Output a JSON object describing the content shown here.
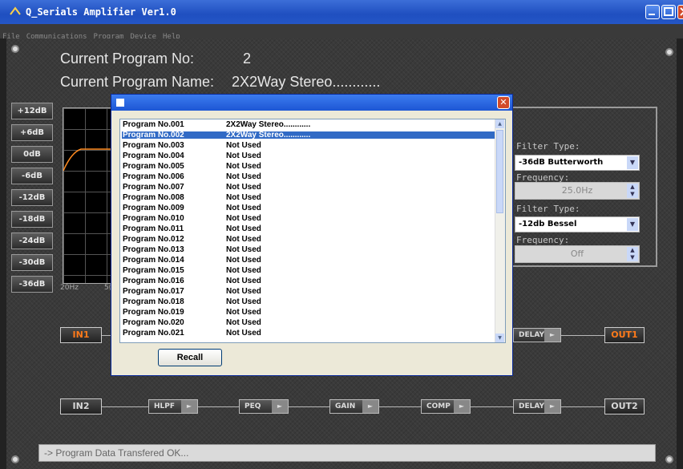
{
  "window": {
    "title": "Q_Serials Amplifier Ver1.0"
  },
  "menu": [
    "File",
    "Communications",
    "Program",
    "Device",
    "Help"
  ],
  "program": {
    "no_label": "Current Program No:",
    "no_value": "2",
    "name_label": "Current Program Name:",
    "name_value": "2X2Way Stereo............"
  },
  "db_buttons": [
    "+12dB",
    "+6dB",
    "0dB",
    "-6dB",
    "-12dB",
    "-18dB",
    "-24dB",
    "-30dB",
    "-36dB"
  ],
  "graph": {
    "x_label_start": "20Hz",
    "x_label_partial": "5("
  },
  "filters": {
    "hp_type_label": "Filter Type:",
    "hp_type_value": "-36dB Butterworth",
    "hp_freq_label": "Frequency:",
    "hp_freq_value": "25.0Hz",
    "lp_type_label": "Filter Type:",
    "lp_type_value": "-12db Bessel",
    "lp_freq_label": "Frequency:",
    "lp_freq_value": "Off"
  },
  "chain1": {
    "in": "IN1",
    "delay": "DELAY",
    "out": "OUT1"
  },
  "chain2": {
    "in": "IN2",
    "hlpf": "HLPF",
    "peq": "PEQ",
    "gain": "GAIN",
    "comp": "COMP",
    "delay": "DELAY",
    "out": "OUT2"
  },
  "colors": {
    "io_accent": "#ff7a1a",
    "selection": "#316ac5"
  },
  "dialog": {
    "close": "✕",
    "recall_label": "Recall",
    "programs": [
      {
        "no": "Program No.001",
        "name": "2X2Way Stereo............"
      },
      {
        "no": "Program No.002",
        "name": "2X2Way Stereo............",
        "selected": true
      },
      {
        "no": "Program No.003",
        "name": "Not Used"
      },
      {
        "no": "Program No.004",
        "name": "Not Used"
      },
      {
        "no": "Program No.005",
        "name": "Not Used"
      },
      {
        "no": "Program No.006",
        "name": "Not Used"
      },
      {
        "no": "Program No.007",
        "name": "Not Used"
      },
      {
        "no": "Program No.008",
        "name": "Not Used"
      },
      {
        "no": "Program No.009",
        "name": "Not Used"
      },
      {
        "no": "Program No.010",
        "name": "Not Used"
      },
      {
        "no": "Program No.011",
        "name": "Not Used"
      },
      {
        "no": "Program No.012",
        "name": "Not Used"
      },
      {
        "no": "Program No.013",
        "name": "Not Used"
      },
      {
        "no": "Program No.014",
        "name": "Not Used"
      },
      {
        "no": "Program No.015",
        "name": "Not Used"
      },
      {
        "no": "Program No.016",
        "name": "Not Used"
      },
      {
        "no": "Program No.017",
        "name": "Not Used"
      },
      {
        "no": "Program No.018",
        "name": "Not Used"
      },
      {
        "no": "Program No.019",
        "name": "Not Used"
      },
      {
        "no": "Program No.020",
        "name": "Not Used"
      },
      {
        "no": "Program No.021",
        "name": "Not Used"
      }
    ]
  },
  "status": {
    "text": "-> Program Data Transfered OK..."
  }
}
